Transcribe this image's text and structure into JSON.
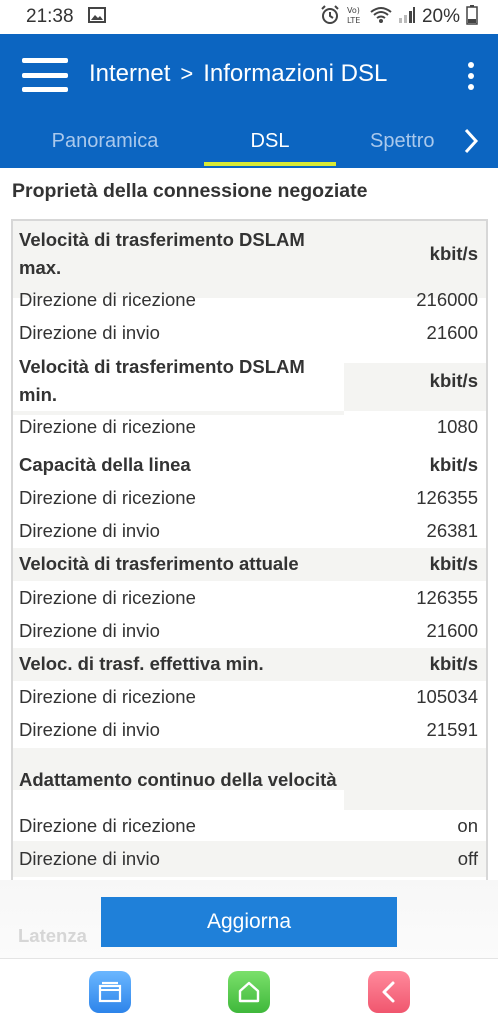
{
  "status_bar": {
    "time": "21:38",
    "battery_percent": "20%",
    "icons": [
      "image-icon",
      "alarm-icon",
      "volte-icon",
      "wifi-icon",
      "signal-icon",
      "battery-icon"
    ]
  },
  "header": {
    "breadcrumb_root": "Internet",
    "separator": ">",
    "breadcrumb_current": "Informazioni DSL",
    "background_color": "#0c65c1"
  },
  "tabs": [
    {
      "label": "Panoramica",
      "active": false
    },
    {
      "label": "DSL",
      "active": true
    },
    {
      "label": "Spettro",
      "active": false
    }
  ],
  "section_title": "Proprietà della connessione negoziate",
  "rows": [
    {
      "label": "Velocità di trasferimento DSLAM max.",
      "value": "kbit/s",
      "type": "header"
    },
    {
      "label": "Direzione di ricezione",
      "value": "216000",
      "type": "item"
    },
    {
      "label": "Direzione di invio",
      "value": "21600",
      "type": "item"
    },
    {
      "label": "Velocità di trasferimento DSLAM min.",
      "value": "kbit/s",
      "type": "header"
    },
    {
      "label": "Direzione di ricezione",
      "value": "1080",
      "type": "item"
    },
    {
      "label": "Capacità della linea",
      "value": "kbit/s",
      "type": "header"
    },
    {
      "label": "Direzione di ricezione",
      "value": "126355",
      "type": "item"
    },
    {
      "label": "Direzione di invio",
      "value": "26381",
      "type": "item"
    },
    {
      "label": "Velocità di trasferimento attuale",
      "value": "kbit/s",
      "type": "header"
    },
    {
      "label": "Direzione di ricezione",
      "value": "126355",
      "type": "item"
    },
    {
      "label": "Direzione di invio",
      "value": "21600",
      "type": "item"
    },
    {
      "label": "Veloc. di trasf. effettiva min.",
      "value": "kbit/s",
      "type": "header"
    },
    {
      "label": "Direzione di ricezione",
      "value": "105034",
      "type": "item"
    },
    {
      "label": "Direzione di invio",
      "value": "21591",
      "type": "item"
    },
    {
      "label": "Adattamento continuo della velocità",
      "value": "",
      "type": "header"
    },
    {
      "label": "Direzione di ricezione",
      "value": "on",
      "type": "item"
    },
    {
      "label": "Direzione di invio",
      "value": "off",
      "type": "item"
    }
  ],
  "footer": {
    "partial_label": "Latenza",
    "update_button": "Aggiorna",
    "button_color": "#1f80d9"
  },
  "bottom_nav": [
    "recent-apps-icon",
    "home-icon",
    "back-icon"
  ]
}
